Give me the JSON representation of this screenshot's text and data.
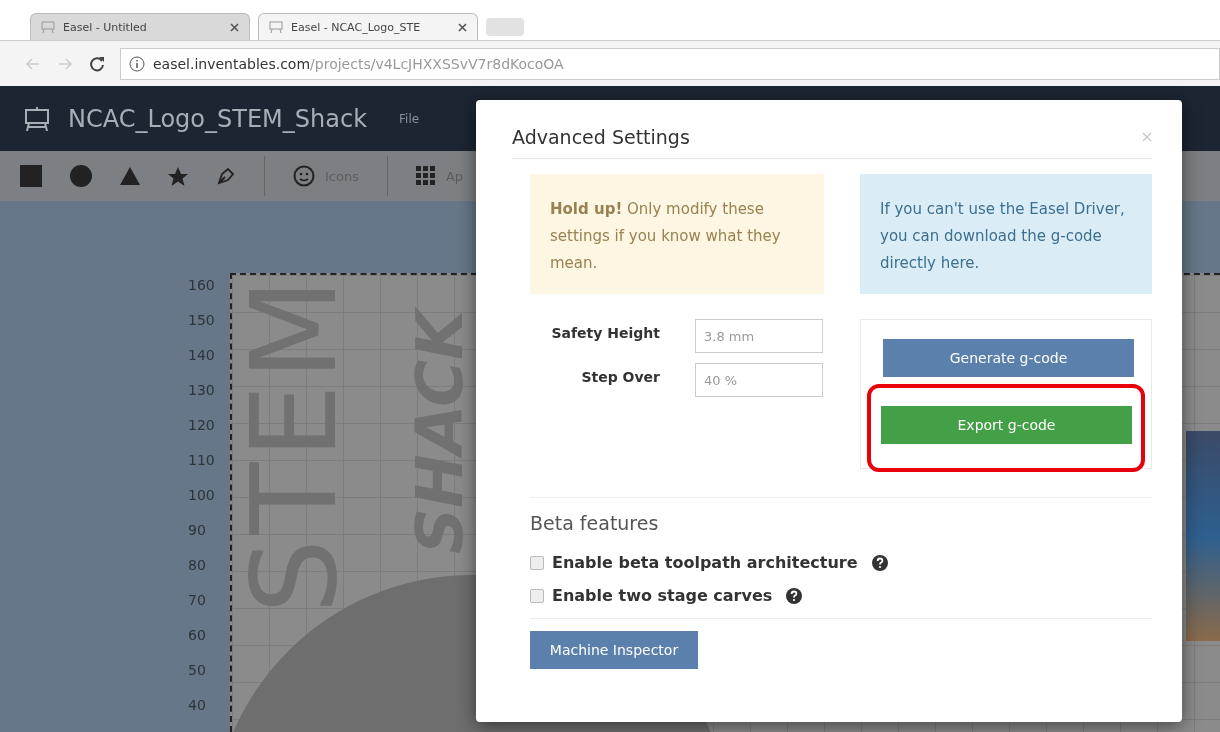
{
  "browser": {
    "tabs": [
      {
        "title": "Easel - Untitled",
        "selected": false
      },
      {
        "title": "Easel - NCAC_Logo_STE",
        "selected": true
      }
    ],
    "url": {
      "host": "easel.inventables.com",
      "path": "/projects/v4LcJHXXSSvV7r8dKocoOA"
    }
  },
  "app": {
    "project_title": "NCAC_Logo_STEM_Shack",
    "menu": [
      "File"
    ],
    "toolbar": [
      {
        "kind": "square"
      },
      {
        "kind": "circle"
      },
      {
        "kind": "triangle"
      },
      {
        "kind": "star"
      },
      {
        "kind": "pen"
      },
      {
        "kind": "icons",
        "label": "Icons"
      },
      {
        "kind": "apps",
        "label": "Ap"
      }
    ]
  },
  "canvas": {
    "ruler": [
      "160",
      "150",
      "140",
      "130",
      "120",
      "110",
      "100",
      "90",
      "80",
      "70",
      "60",
      "50",
      "40"
    ],
    "design_texts": [
      "STEM",
      "SHACK"
    ]
  },
  "dialog": {
    "title": "Advanced Settings",
    "warning": "**Hold up!** Only modify these settings if you know what they mean.",
    "info": "If you can't use the Easel Driver, you can download the g-code directly here.",
    "fields": [
      {
        "label": "Safety Height",
        "value": "3.8 mm"
      },
      {
        "label": "Step Over",
        "value": "40 %"
      }
    ],
    "actions": [
      {
        "label": "Generate g-code",
        "kind": "primary",
        "highlighted": false
      },
      {
        "label": "Export g-code",
        "kind": "success",
        "highlighted": true
      }
    ],
    "beta_title": "Beta features",
    "beta_options": [
      {
        "label": "Enable beta toolpath architecture",
        "checked": false
      },
      {
        "label": "Enable two stage carves",
        "checked": false
      }
    ],
    "footer_button": "Machine Inspector"
  }
}
